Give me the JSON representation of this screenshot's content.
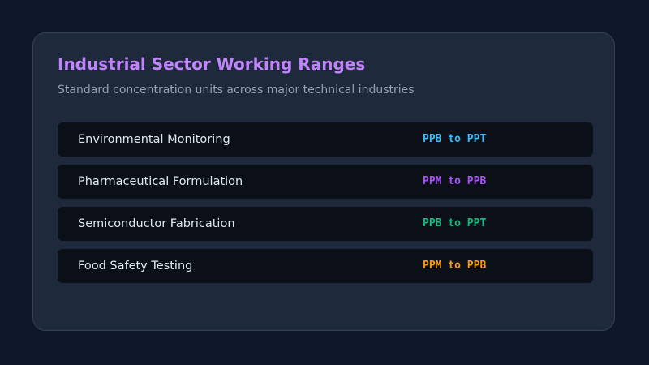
{
  "card": {
    "title": "Industrial Sector Working Ranges",
    "subtitle": "Standard concentration units across major technical industries"
  },
  "rows": [
    {
      "label": "Environmental Monitoring",
      "range": "PPB to PPT",
      "color": "#38bdf8"
    },
    {
      "label": "Pharmaceutical Formulation",
      "range": "PPM to PPB",
      "color": "#a855f7"
    },
    {
      "label": "Semiconductor Fabrication",
      "range": "PPB to PPT",
      "color": "#10b981"
    },
    {
      "label": "Food Safety Testing",
      "range": "PPM to PPB",
      "color": "#f59e0b"
    }
  ]
}
